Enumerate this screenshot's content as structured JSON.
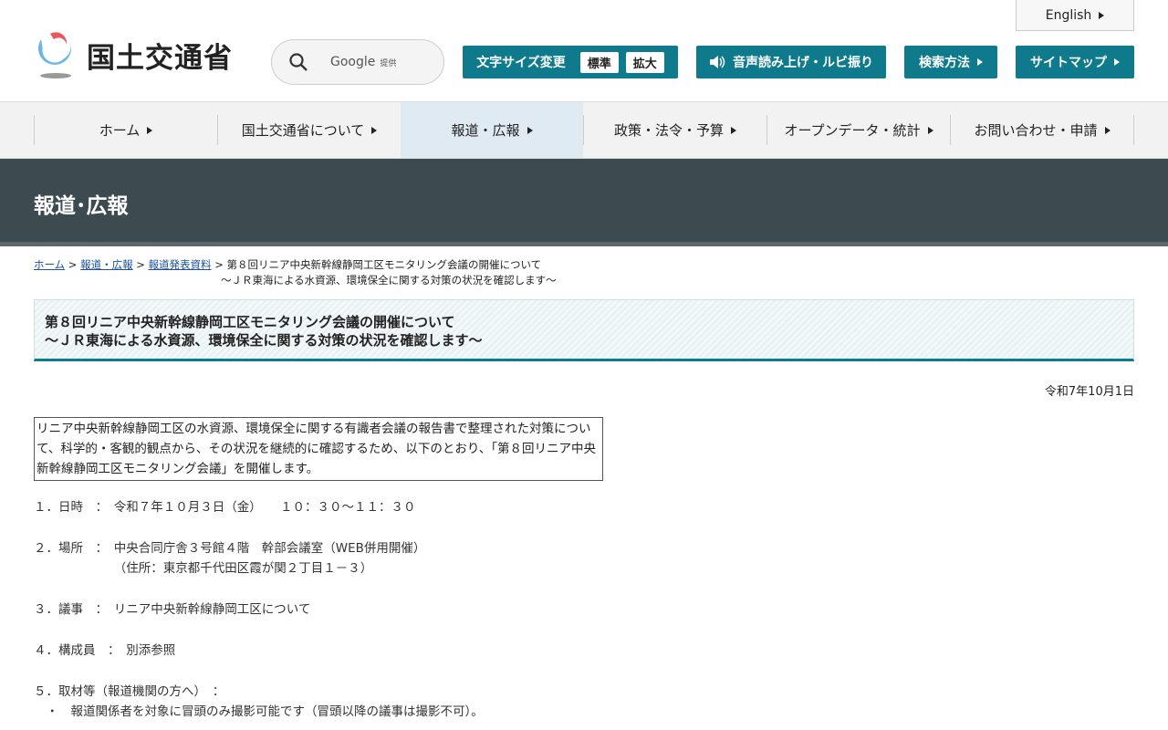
{
  "header": {
    "logo_text": "国土交通省",
    "search_brand": "Google",
    "search_suffix": "提供",
    "font_size_label": "文字サイズ変更",
    "font_standard": "標準",
    "font_large": "拡大",
    "reader": "音声読み上げ・ルビ振り",
    "search_method": "検索方法",
    "sitemap": "サイトマップ",
    "english": "English"
  },
  "nav": [
    "ホーム",
    "国土交通省について",
    "報道・広報",
    "政策・法令・予算",
    "オープンデータ・統計",
    "お問い合わせ・申請"
  ],
  "band_title": "報道･広報",
  "breadcrumb": {
    "home": "ホーム",
    "press": "報道・広報",
    "releases": "報道発表資料",
    "current1": "第８回リニア中央新幹線静岡工区モニタリング会議の開催について",
    "current2": "～ＪＲ東海による水資源、環境保全に関する対策の状況を確認します～"
  },
  "title1": "第８回リニア中央新幹線静岡工区モニタリング会議の開催について",
  "title2": "～ＪＲ東海による水資源、環境保全に関する対策の状況を確認します～",
  "date": "令和7年10月1日",
  "summary": "リニア中央新幹線静岡工区の水資源、環境保全に関する有識者会議の報告書で整理された対策について、科学的・客観的観点から、その状況を継続的に確認するため、以下のとおり、「第８回リニア中央新幹線静岡工区モニタリング会議」を開催します。",
  "items": {
    "i1": "１．日時　：　令和７年１０月３日（金）　　１０：３０～１１：３０",
    "i2a": "２．場所　：　中央合同庁舎３号館４階　幹部会議室（WEB併用開催）",
    "i2b": "　　　　　　　（住所：東京都千代田区霞が関２丁目１－３）",
    "i3": "３．議事　：　リニア中央新幹線静岡工区について",
    "i4": "４．構成員　：　別添参照",
    "i5": "５．取材等（報道機関の方へ）　：",
    "i5a": "　・　報道関係者を対象に冒頭のみ撮影可能です（冒頭以降の議事は撮影不可）。"
  }
}
